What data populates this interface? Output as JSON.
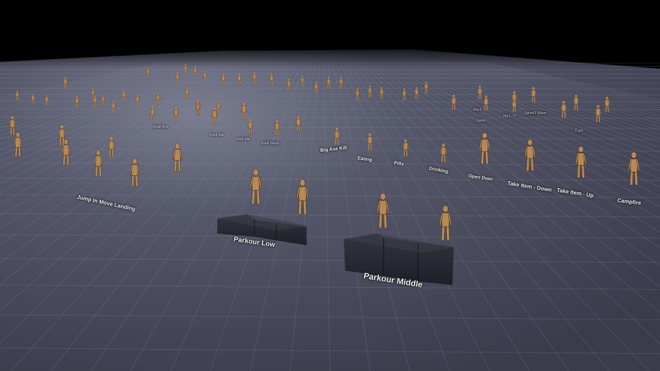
{
  "scene": {
    "type": "3d-animation-showcase-level",
    "background_color": "#000000",
    "floor_color": "#4a4c5e",
    "grid_color": "#7a7c92",
    "mannequin_color": "#b68a58",
    "block_color": "#2a2c37"
  },
  "labels": {
    "jump_in_move_landing": "Jump In Move Landing",
    "parkour_low": "Parkour Low",
    "parkour_middle": "Parkour Middle",
    "big_axe_kill": "Big Axe Kill",
    "eating": "Eating",
    "pills": "Pills",
    "drinking": "Drinking",
    "open_door": "Open Door",
    "take_item_down": "Take Item - Down",
    "take_item_up": "Take Item - Up",
    "campfire": "Campfire",
    "turn": "Turn",
    "knell_idle": "Knell Idle",
    "knell_idle_2": "Knell Idle",
    "knell_stand": "Knell Stand",
    "small_box": "Small Box",
    "sprint_f_wave": "Sprint F Wave",
    "jog_l_r": "Jog L / R",
    "sprint": "Sprint",
    "jog_f": "Jog F"
  }
}
